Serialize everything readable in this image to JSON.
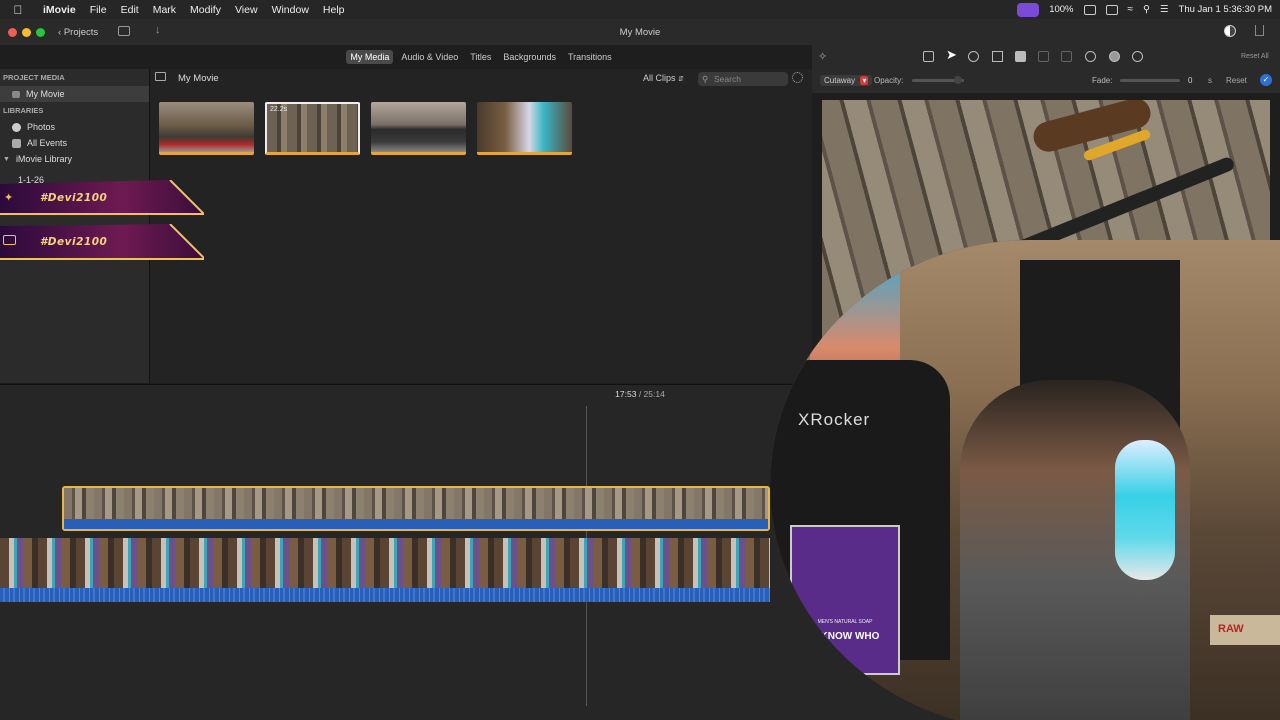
{
  "menubar": {
    "app_name": "iMovie",
    "menus": [
      "File",
      "Edit",
      "Mark",
      "Modify",
      "View",
      "Window",
      "Help"
    ],
    "battery": "100%",
    "clock": "Thu Jan 1  5:36:30 PM"
  },
  "window": {
    "projects_label": "Projects",
    "title": "My Movie"
  },
  "browser": {
    "tabs": [
      "My Media",
      "Audio & Video",
      "Titles",
      "Backgrounds",
      "Transitions"
    ],
    "active_tab": "My Media",
    "heading": "My Movie",
    "filter": "All Clips",
    "search_placeholder": "Search",
    "clip_duration_badge": "22.2s"
  },
  "sidebar": {
    "project_media_header": "PROJECT MEDIA",
    "project_item": "My Movie",
    "libraries_header": "LIBRARIES",
    "photos": "Photos",
    "all_events": "All Events",
    "library": "iMovie Library",
    "event": "1-1-26"
  },
  "overlay": {
    "handle_twitter": "#Devi2100",
    "handle_youtube": "#Devi2100"
  },
  "viewer": {
    "overlay_mode": "Cutaway",
    "opacity_label": "Opacity:",
    "fade_label": "Fade:",
    "fade_value": "0",
    "fade_unit": "s",
    "reset": "Reset",
    "reset_all": "Reset All"
  },
  "timeline": {
    "current": "17:53",
    "total": "25:14"
  },
  "webcam": {
    "chair_brand": "XRocker",
    "soap_label": "U KNOW WHO",
    "soap_sub": "MEN'S NATURAL SOAP",
    "raw_label": "RAW"
  },
  "colors": {
    "accent": "#e8b74a",
    "audio": "#2a5fb8",
    "menubar_pill": "#7b4ad6"
  }
}
